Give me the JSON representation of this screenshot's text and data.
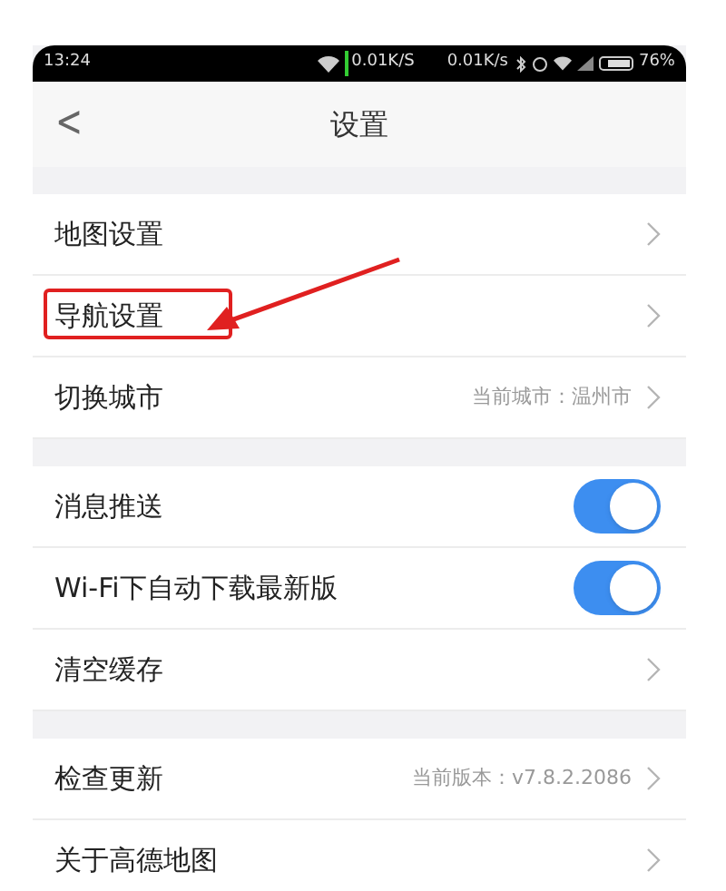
{
  "status_bar": {
    "time": "13:24",
    "overlay_speed": "0.01K/S",
    "speed": "0.01K/s",
    "battery": "76%"
  },
  "header": {
    "back": "<",
    "title": "设置"
  },
  "sections": [
    {
      "rows": [
        {
          "kind": "link",
          "label": "地图设置",
          "annotated": false
        },
        {
          "kind": "link",
          "label": "导航设置",
          "annotated": true
        },
        {
          "kind": "link",
          "label": "切换城市",
          "value": "当前城市：温州市",
          "annotated": false
        }
      ]
    },
    {
      "rows": [
        {
          "kind": "toggle",
          "label": "消息推送",
          "on": true,
          "annotated": false
        },
        {
          "kind": "toggle",
          "label": "Wi-Fi下自动下载最新版",
          "on": true,
          "annotated": false
        },
        {
          "kind": "link",
          "label": "清空缓存",
          "annotated": false
        }
      ]
    },
    {
      "rows": [
        {
          "kind": "link",
          "label": "检查更新",
          "value": "当前版本：v7.8.2.2086",
          "annotated": false
        },
        {
          "kind": "link",
          "label": "关于高德地图",
          "annotated": false
        }
      ]
    }
  ]
}
